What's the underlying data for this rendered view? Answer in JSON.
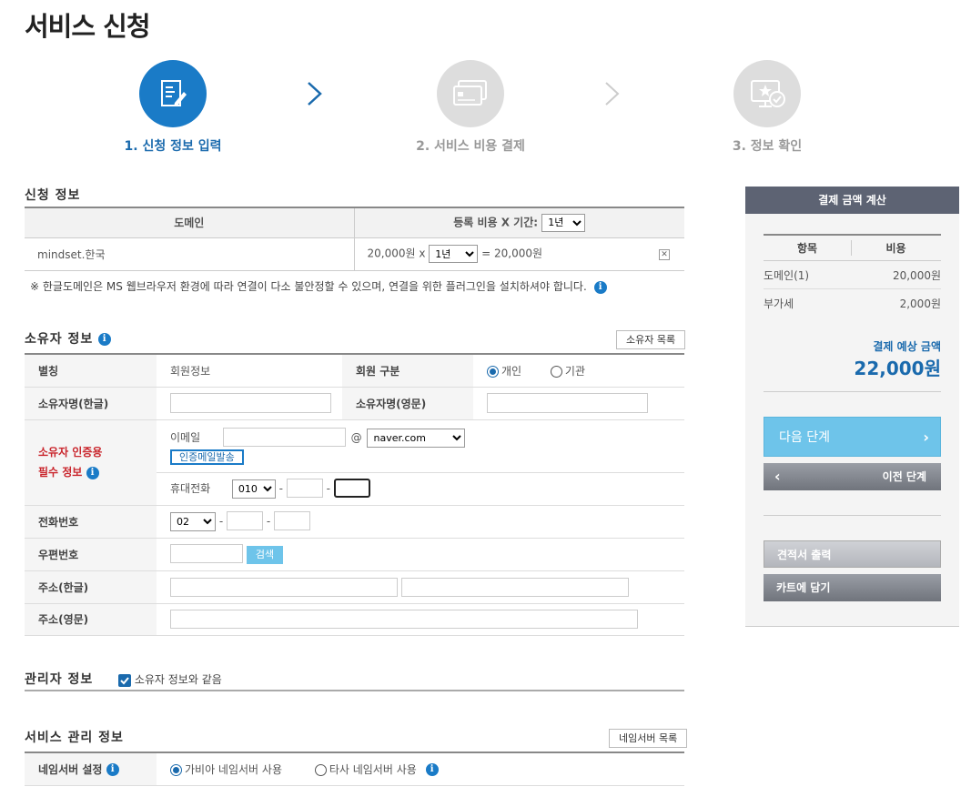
{
  "page": {
    "title": "서비스 신청"
  },
  "steps": [
    {
      "label": "1. 신청 정보 입력"
    },
    {
      "label": "2. 서비스 비용 결제"
    },
    {
      "label": "3. 정보 확인"
    }
  ],
  "application": {
    "title": "신청 정보",
    "col_domain": "도메인",
    "col_fee": "등록 비용 X 기간:",
    "period_select": "1년",
    "domain": "mindset.한국",
    "fee": "20,000원 x",
    "row_period": "1년",
    "total": "= 20,000원",
    "notice": "※ 한글도메인은 MS 웹브라우저 환경에 따라 연결이 다소 불안정할 수 있으며, 연결을 위한 플러그인을 설치하셔야 합니다."
  },
  "owner": {
    "title": "소유자 정보",
    "list_button": "소유자 목록",
    "alias_label": "별칭",
    "alias_value": "회원정보",
    "member_type_label": "회원 구분",
    "member_type_personal": "개인",
    "member_type_org": "기관",
    "name_kr_label": "소유자명(한글)",
    "name_en_label": "소유자명(영문)",
    "auth_label_1": "소유자 인증용",
    "auth_label_2": "필수 정보",
    "email_label": "이메일",
    "email_at": "@",
    "email_domain": "naver.com",
    "send_mail_button": "인증메일발송",
    "mobile_label": "휴대전화",
    "mobile_prefix": "010",
    "dash": "-",
    "phone_label": "전화번호",
    "phone_prefix": "02",
    "zip_label": "우편번호",
    "search_button": "검색",
    "addr_kr_label": "주소(한글)",
    "addr_en_label": "주소(영문)"
  },
  "admin": {
    "title": "관리자 정보",
    "same_as_owner": "소유자 정보와 같음"
  },
  "service": {
    "title": "서비스 관리 정보",
    "ns_list_button": "네임서버 목록",
    "ns_label": "네임서버 설정",
    "ns_gabia": "가비아 네임서버 사용",
    "ns_other": "타사 네임서버 사용"
  },
  "sidebar": {
    "title": "결제 금액 계산",
    "col_item": "항목",
    "col_cost": "비용",
    "rows": [
      {
        "item": "도메인(1)",
        "cost": "20,000원"
      },
      {
        "item": "부가세",
        "cost": "2,000원"
      }
    ],
    "expected_label": "결제 예상 금액",
    "expected_amount": "22,000원",
    "next_button": "다음 단계",
    "prev_button": "이전 단계",
    "estimate_button": "견적서 출력",
    "cart_button": "카트에 담기"
  },
  "colors": {
    "primary": "#1a7bc7",
    "next_button": "#6ec4ea",
    "sidebar_header": "#5d6373"
  }
}
